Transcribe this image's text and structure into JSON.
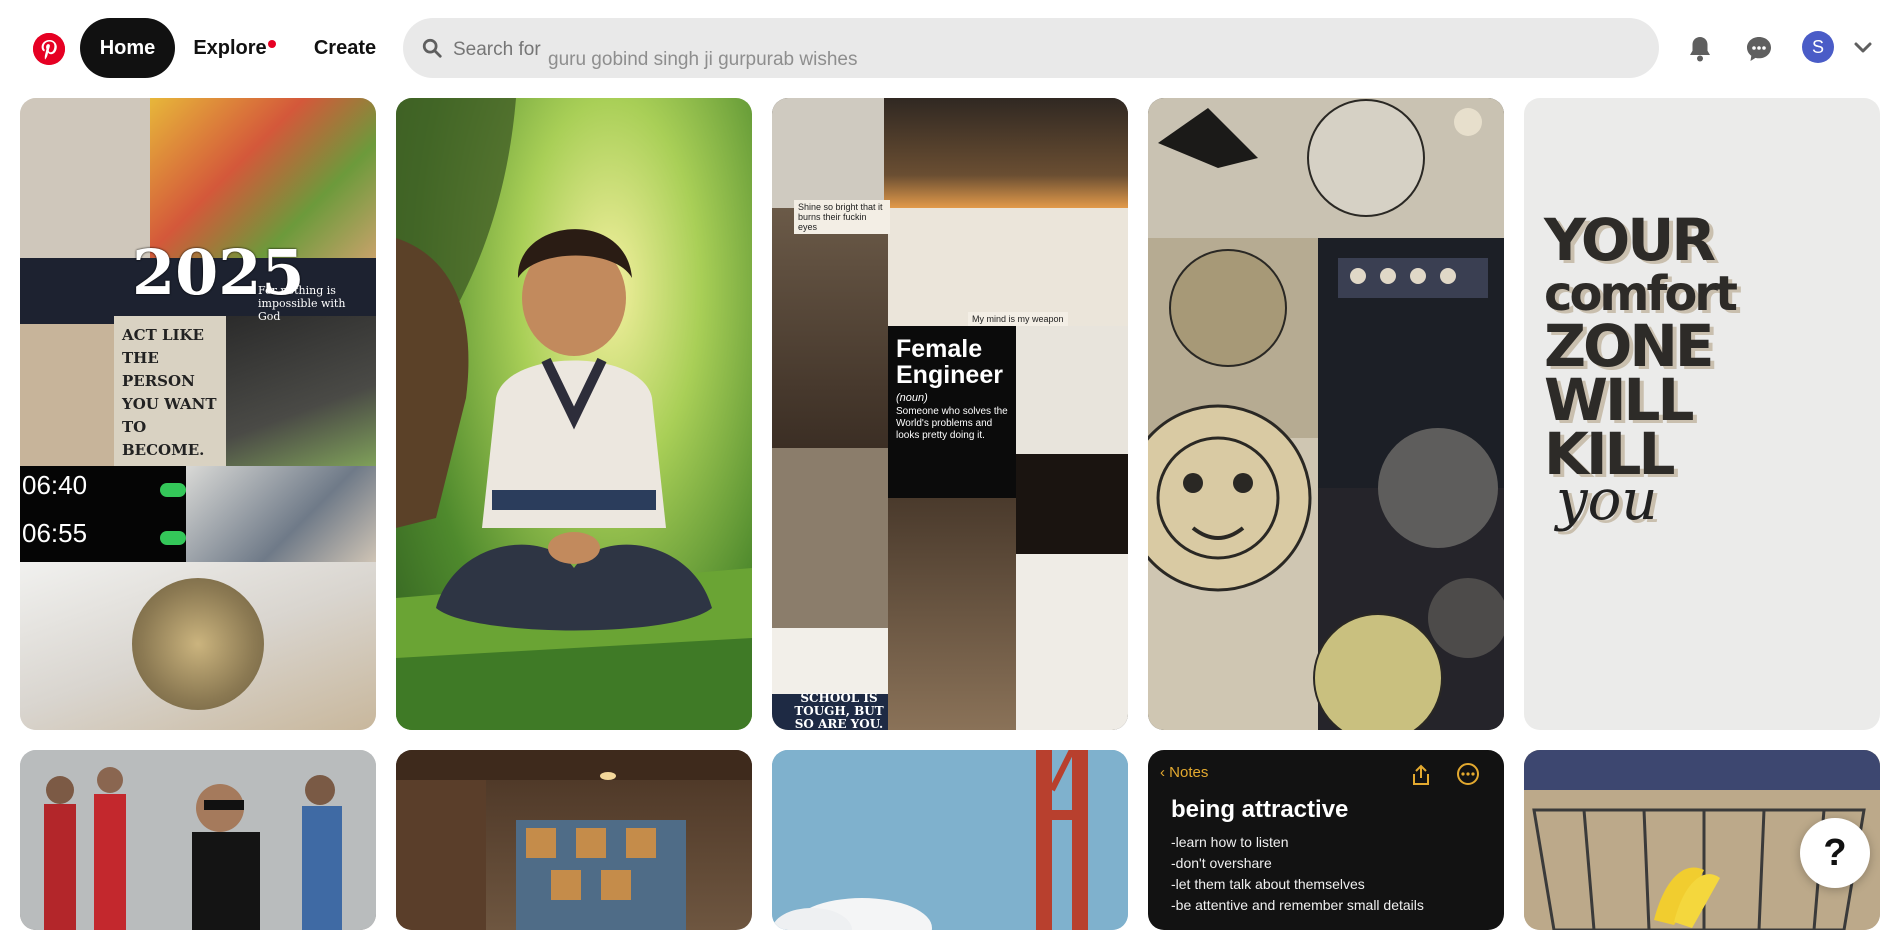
{
  "brand": {
    "color": "#e60023"
  },
  "nav": {
    "home": "Home",
    "explore": "Explore",
    "create": "Create"
  },
  "search": {
    "prefix": "Search for",
    "suggestion": "guru gobind singh ji gurpurab wishes"
  },
  "header": {
    "avatar_initial": "S"
  },
  "pins": {
    "p1": {
      "year": "2025",
      "quote": "ACT LIKE THE PERSON YOU WANT TO BECOME.",
      "god": "For nothing is impossible with God",
      "alarm1": "06:40",
      "alarm2": "06:55"
    },
    "p3": {
      "fe_title": "Female Engineer",
      "fe_noun": "(noun)",
      "fe_desc": "Someone who solves the World's problems and looks pretty doing it.",
      "school": "SCHOOL IS TOUGH, BUT SO ARE YOU.",
      "note1": "My mind is my weapon",
      "note2": "Shine so bright that it burns their fuckin eyes"
    },
    "p5": {
      "line1": "YOUR",
      "line2": "comfort",
      "line3": "ZONE",
      "line4": "WILL",
      "line5": "KILL",
      "line6": "you"
    },
    "p9": {
      "back": "Notes",
      "title": "being attractive",
      "items": [
        "-learn how to listen",
        "-don't overshare",
        "-let them talk about themselves",
        "-be attentive and remember small details"
      ]
    }
  },
  "help": {
    "label": "?"
  }
}
